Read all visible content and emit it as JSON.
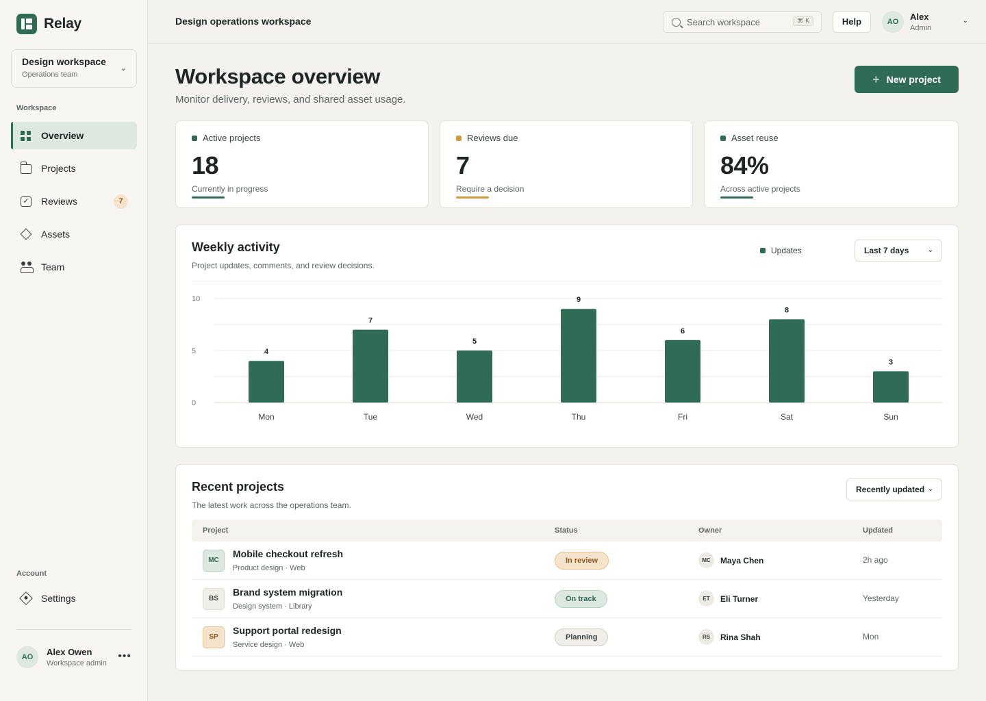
{
  "app": {
    "name": "Relay"
  },
  "workspace_switcher": {
    "name": "Design workspace",
    "team": "Operations team"
  },
  "sidebar": {
    "section_workspace": "Workspace",
    "items": [
      {
        "label": "Overview",
        "icon": "grid-icon",
        "active": true
      },
      {
        "label": "Projects",
        "icon": "folder-icon"
      },
      {
        "label": "Reviews",
        "icon": "checkbox-icon",
        "badge": "7"
      },
      {
        "label": "Assets",
        "icon": "diamond-icon"
      },
      {
        "label": "Team",
        "icon": "team-icon"
      }
    ],
    "section_account": "Account",
    "settings_label": "Settings",
    "user": {
      "initials": "AO",
      "name": "Alex Owen",
      "role": "Workspace admin"
    }
  },
  "topbar": {
    "title": "Design operations workspace",
    "search_placeholder": "Search workspace",
    "search_shortcut": "⌘ K",
    "help_label": "Help",
    "user": {
      "initials": "AO",
      "name": "Alex",
      "role": "Admin"
    }
  },
  "page": {
    "title": "Workspace overview",
    "subtitle": "Monitor delivery, reviews, and shared asset usage.",
    "new_project_label": "New project"
  },
  "stats": [
    {
      "label": "Active projects",
      "value": "18",
      "note": "Currently in progress",
      "color": "#2f6b55"
    },
    {
      "label": "Reviews due",
      "value": "7",
      "note": "Require a decision",
      "color": "#d49a3f"
    },
    {
      "label": "Asset reuse",
      "value": "84%",
      "note": "Across active projects",
      "color": "#2f6b55"
    }
  ],
  "activity": {
    "title": "Weekly activity",
    "subtitle": "Project updates, comments, and review decisions.",
    "legend": "Updates",
    "range_label": "Last 7 days"
  },
  "chart_data": {
    "type": "bar",
    "categories": [
      "Mon",
      "Tue",
      "Wed",
      "Thu",
      "Fri",
      "Sat",
      "Sun"
    ],
    "series": [
      {
        "name": "Updates",
        "values": [
          4,
          7,
          5,
          9,
          6,
          8,
          3
        ]
      }
    ],
    "ylim": [
      0,
      10
    ],
    "yticks": [
      0,
      5,
      10
    ],
    "data_labels": true,
    "grid": true,
    "legend": "top-right",
    "bar_color": "#2f6b55"
  },
  "recent": {
    "title": "Recent projects",
    "subtitle": "The latest work across the operations team.",
    "sort_label": "Recently updated",
    "columns": [
      "Project",
      "Status",
      "Owner",
      "Updated"
    ],
    "rows": [
      {
        "initials": "MC",
        "name": "Mobile checkout refresh",
        "meta": "Product design · Web",
        "status": "In review",
        "owner_initials": "MC",
        "owner": "Maya Chen",
        "updated": "2h ago"
      },
      {
        "initials": "BS",
        "name": "Brand system migration",
        "meta": "Design system · Library",
        "status": "On track",
        "owner_initials": "ET",
        "owner": "Eli Turner",
        "updated": "Yesterday"
      },
      {
        "initials": "SP",
        "name": "Support portal redesign",
        "meta": "Service design · Web",
        "status": "Planning",
        "owner_initials": "RS",
        "owner": "Rina Shah",
        "updated": "Mon"
      }
    ]
  },
  "colors": {
    "accent": "#2f6b55",
    "warning": "#d49a3f",
    "background": "#f3f2ee",
    "status_in_review": "#f6e3cc",
    "status_on_track": "#dde8e1",
    "status_planning": "#eceae4"
  }
}
